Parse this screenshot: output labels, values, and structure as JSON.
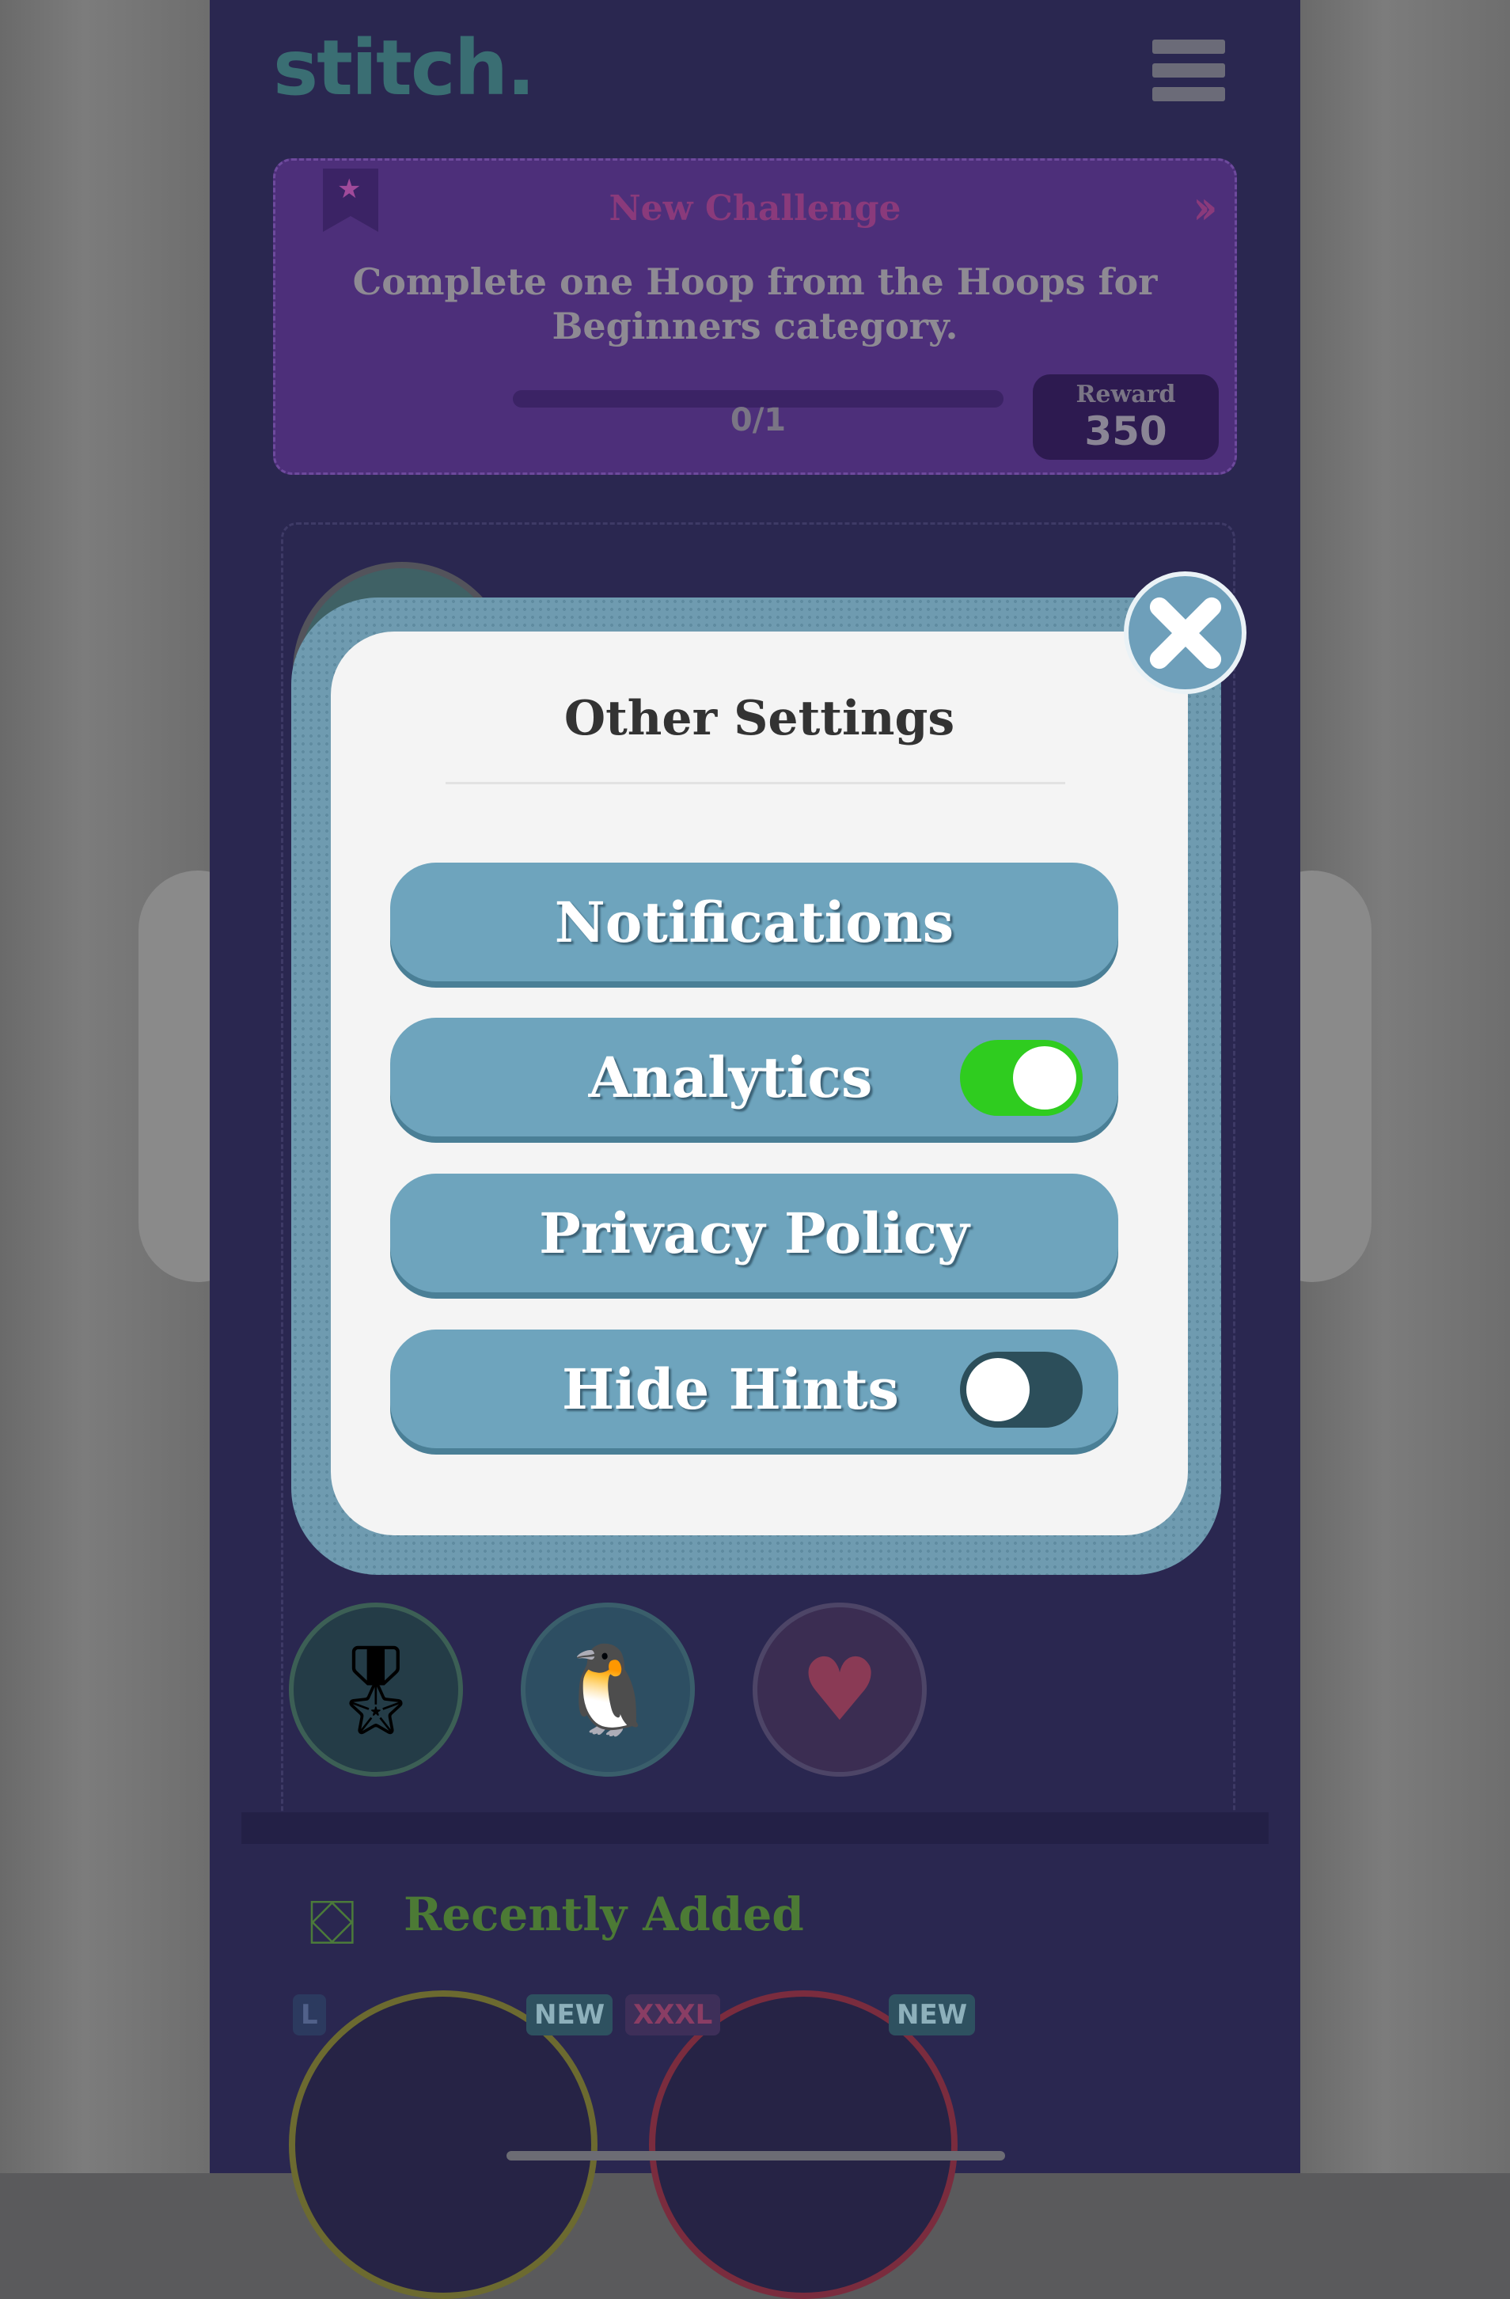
{
  "app": {
    "logo": "stitch."
  },
  "challenge": {
    "title": "New Challenge",
    "description": "Complete one Hoop from the Hoops for Beginners category.",
    "progress": "0/1",
    "reward_label": "Reward",
    "reward_value": "350"
  },
  "modal": {
    "title": "Other Settings",
    "buttons": [
      {
        "label": "Notifications"
      },
      {
        "label": "Analytics",
        "toggle": "on"
      },
      {
        "label": "Privacy Policy"
      },
      {
        "label": "Hide Hints",
        "toggle": "off"
      }
    ]
  },
  "categories": [
    {
      "icon": "nutcracker-icon"
    },
    {
      "icon": "penguin-icon"
    },
    {
      "icon": "heart-icon"
    }
  ],
  "recent": {
    "title": "Recently Added",
    "badges": [
      "L",
      "NEW",
      "XXXL",
      "NEW"
    ]
  },
  "colors": {
    "modal_button": "#6ea4bd",
    "toggle_on": "#2fcc1f",
    "toggle_off": "#2c4e5a",
    "app_background": "#2a2750"
  }
}
